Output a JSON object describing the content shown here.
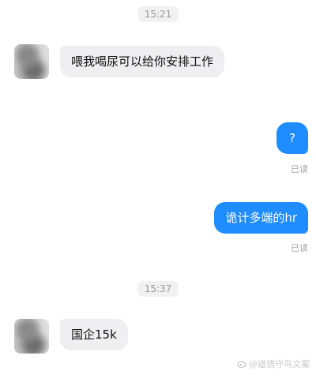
{
  "timestamps": [
    "15:21",
    "15:37"
  ],
  "messages": [
    {
      "side": "incoming",
      "text": "喂我喝尿可以给你安排工作"
    },
    {
      "side": "outgoing",
      "text": "?",
      "status": "已读"
    },
    {
      "side": "outgoing",
      "text": "诡计多端的hr",
      "status": "已读"
    },
    {
      "side": "incoming",
      "text": "国企15k"
    }
  ],
  "watermark": {
    "text": "@道德守鸟文案"
  },
  "colors": {
    "outgoing_bubble": "#1f8cff",
    "incoming_bubble": "#efeff1",
    "background": "#ffffff"
  }
}
